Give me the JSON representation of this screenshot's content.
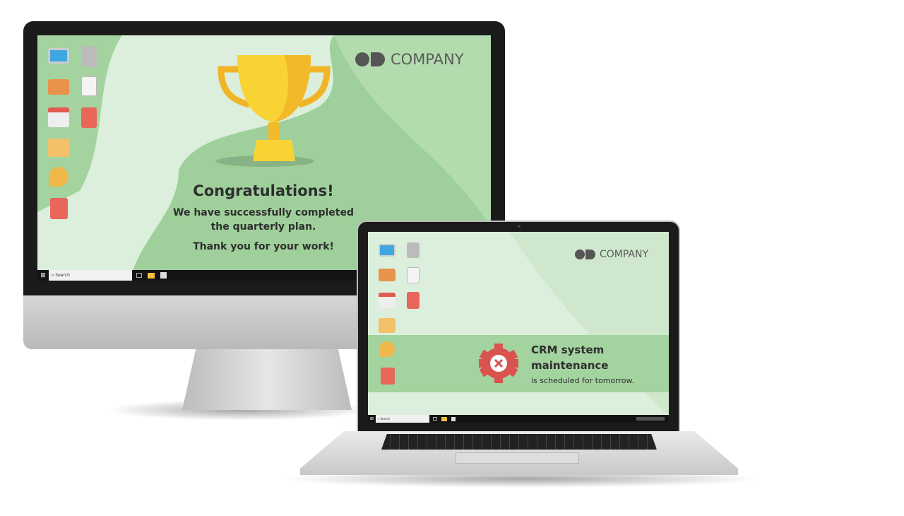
{
  "monitor": {
    "logo_text": "COMPANY",
    "title": "Congratulations!",
    "message_line1": "We have successfully completed",
    "message_line2": "the quarterly plan.",
    "message_line3": "Thank you for your work!",
    "taskbar": {
      "search_placeholder": "Search"
    }
  },
  "laptop": {
    "logo_text": "COMPANY",
    "alert_title_line1": "CRM system",
    "alert_title_line2": "maintenance",
    "alert_subtitle": "is scheduled for tomorrow.",
    "taskbar": {
      "search_placeholder": "Search"
    }
  },
  "colors": {
    "bg_light": "#dcefdc",
    "bg_green": "#9fd09b",
    "alert_red": "#d9534f",
    "trophy": "#f7c531"
  },
  "desktop_icons": [
    "computer-icon",
    "trash-icon",
    "briefcase-icon",
    "document-icon",
    "calendar-icon",
    "sd-card-icon",
    "mail-icon",
    "key-icon",
    "notebook-icon"
  ]
}
